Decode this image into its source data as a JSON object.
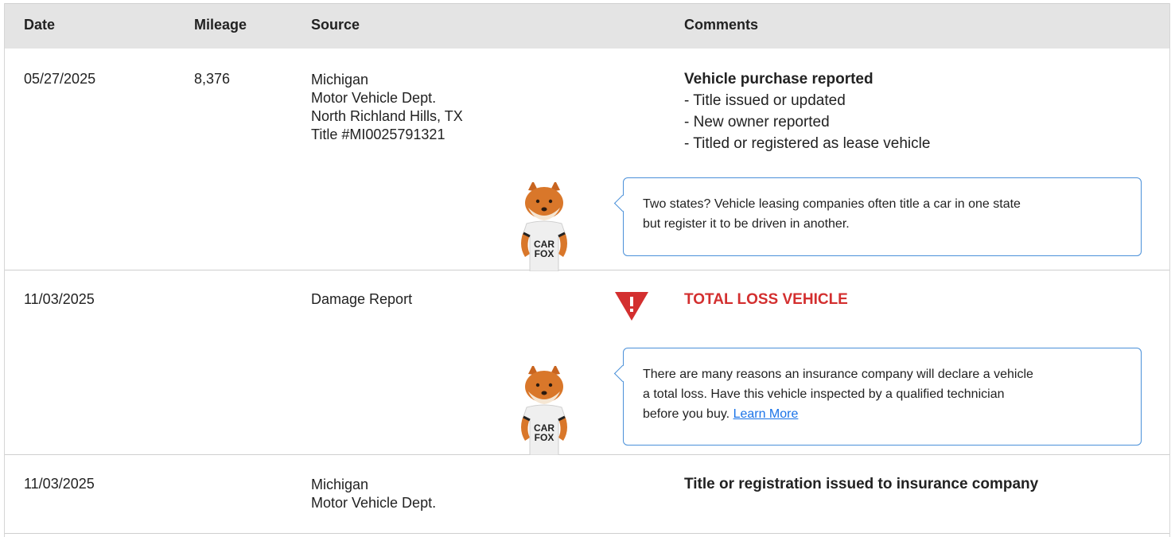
{
  "header": {
    "date": "Date",
    "mileage": "Mileage",
    "source": "Source",
    "comments": "Comments"
  },
  "rows": [
    {
      "date": "05/27/2025",
      "mileage": "8,376",
      "source": [
        "Michigan",
        "Motor Vehicle Dept.",
        "North Richland Hills, TX",
        "Title #MI0025791321"
      ],
      "comment_title": "Vehicle purchase reported",
      "comment_items": [
        "- Title issued or updated",
        "- New owner reported",
        "- Titled or registered as lease vehicle"
      ],
      "tip": {
        "line1": "Two states? Vehicle leasing companies often title a car in one state",
        "line2": "but register it to be driven in another."
      }
    },
    {
      "date": "11/03/2025",
      "mileage": "",
      "source": [
        "Damage Report"
      ],
      "comment_alert": "TOTAL LOSS VEHICLE",
      "tip": {
        "line1": "There are many reasons an insurance company will declare a vehicle",
        "line2": "a total loss. Have this vehicle inspected by a qualified technician",
        "line3": "before you buy.",
        "link": "Learn More"
      }
    },
    {
      "date": "11/03/2025",
      "mileage": "",
      "source": [
        "Michigan",
        "Motor Vehicle Dept."
      ],
      "comment_title": "Title or registration issued to insurance company"
    }
  ],
  "mascot": {
    "shirt_line1": "CAR",
    "shirt_line2": "FOX"
  },
  "icons": {
    "mascot": "carfox-mascot-icon",
    "warning": "warning-triangle-icon"
  },
  "colors": {
    "header_bg": "#e4e4e4",
    "alert_red": "#d32f2f",
    "tip_border": "#4a90d9",
    "link": "#1a73e8"
  }
}
